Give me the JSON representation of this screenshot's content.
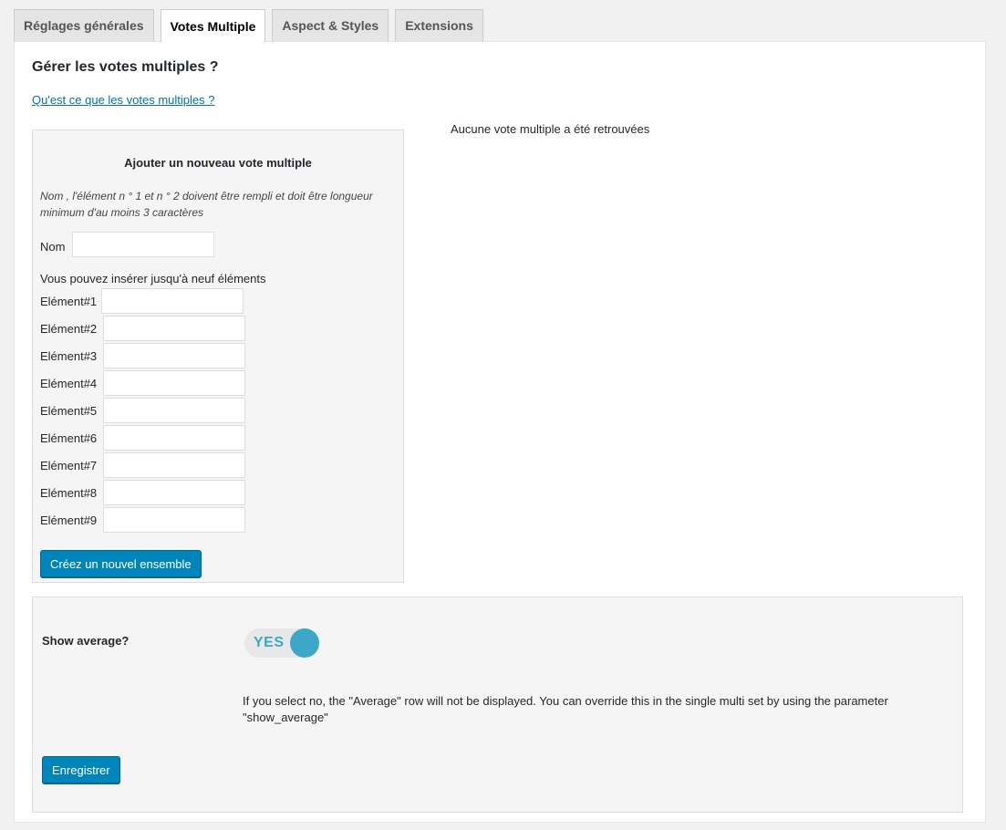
{
  "tabs": [
    {
      "label": "Réglages générales"
    },
    {
      "label": "Votes Multiple"
    },
    {
      "label": "Aspect & Styles"
    },
    {
      "label": "Extensions"
    }
  ],
  "main": {
    "heading": "Gérer les votes multiples ?",
    "help_link": "Qu'est ce que les votes multiples ?",
    "empty_message": "Aucune vote multiple a été retrouvées"
  },
  "add_form": {
    "title": "Ajouter un nouveau vote multiple",
    "note": "Nom , l'élément n ° 1 et n ° 2 doivent être rempli et doit être longueur minimum d'au moins 3 caractères",
    "name_label": "Nom",
    "name_value": "",
    "elements_hint": "Vous pouvez insérer jusqu'à neuf éléments",
    "elements": [
      {
        "label": "Elément#1",
        "value": ""
      },
      {
        "label": "Elément#2",
        "value": ""
      },
      {
        "label": "Elément#3",
        "value": ""
      },
      {
        "label": "Elément#4",
        "value": ""
      },
      {
        "label": "Elément#5",
        "value": ""
      },
      {
        "label": "Elément#6",
        "value": ""
      },
      {
        "label": "Elément#7",
        "value": ""
      },
      {
        "label": "Elément#8",
        "value": ""
      },
      {
        "label": "Elément#9",
        "value": ""
      }
    ],
    "create_button": "Créez un nouvel ensemble"
  },
  "settings": {
    "show_average_label": "Show average?",
    "toggle_text": "YES",
    "toggle_on": true,
    "description": "If you select no, the \"Average\" row will not be displayed. You can override this in the single multi set by using the parameter \"show_average\"",
    "save_button": "Enregistrer"
  },
  "colors": {
    "primary_button": "#0085ba",
    "link": "#0073aa",
    "toggle_accent": "#3ba8c7"
  }
}
